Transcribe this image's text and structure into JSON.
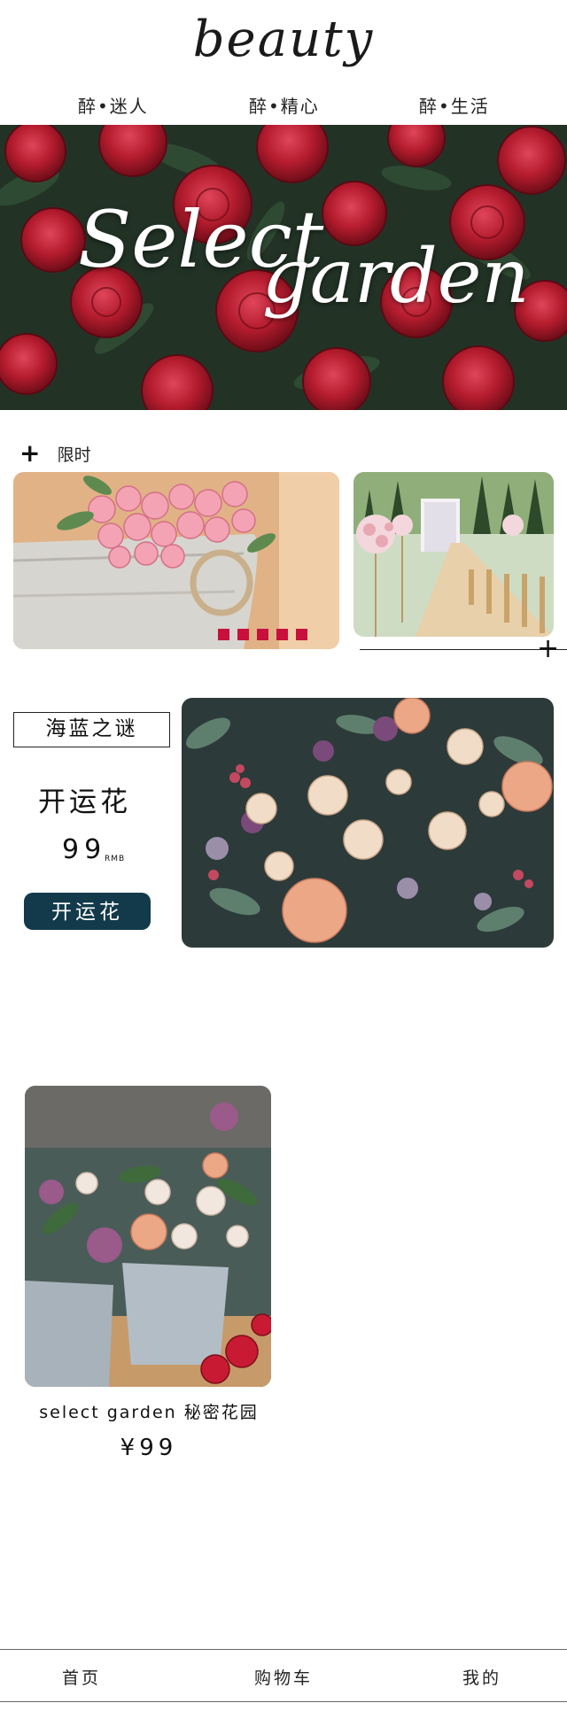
{
  "header": {
    "logo": "beauty",
    "nav": [
      "醉•迷人",
      "醉•精心",
      "醉•生活"
    ]
  },
  "hero": {
    "title_word1": "Select",
    "title_word2": "garden"
  },
  "limited": {
    "label": "限时",
    "slide_indicator_count": 5
  },
  "promo": {
    "tag": "海蓝之谜",
    "name": "开运花",
    "price": "99",
    "unit": "RMB",
    "button": "开运花"
  },
  "product": {
    "name": "select garden 秘密花园",
    "price": "¥99"
  },
  "bottom_nav": [
    "首页",
    "购物车",
    "我的"
  ],
  "colors": {
    "accent_red": "#c8103c",
    "button_navy": "#123a4a"
  },
  "icons": [
    "plus-icon"
  ]
}
